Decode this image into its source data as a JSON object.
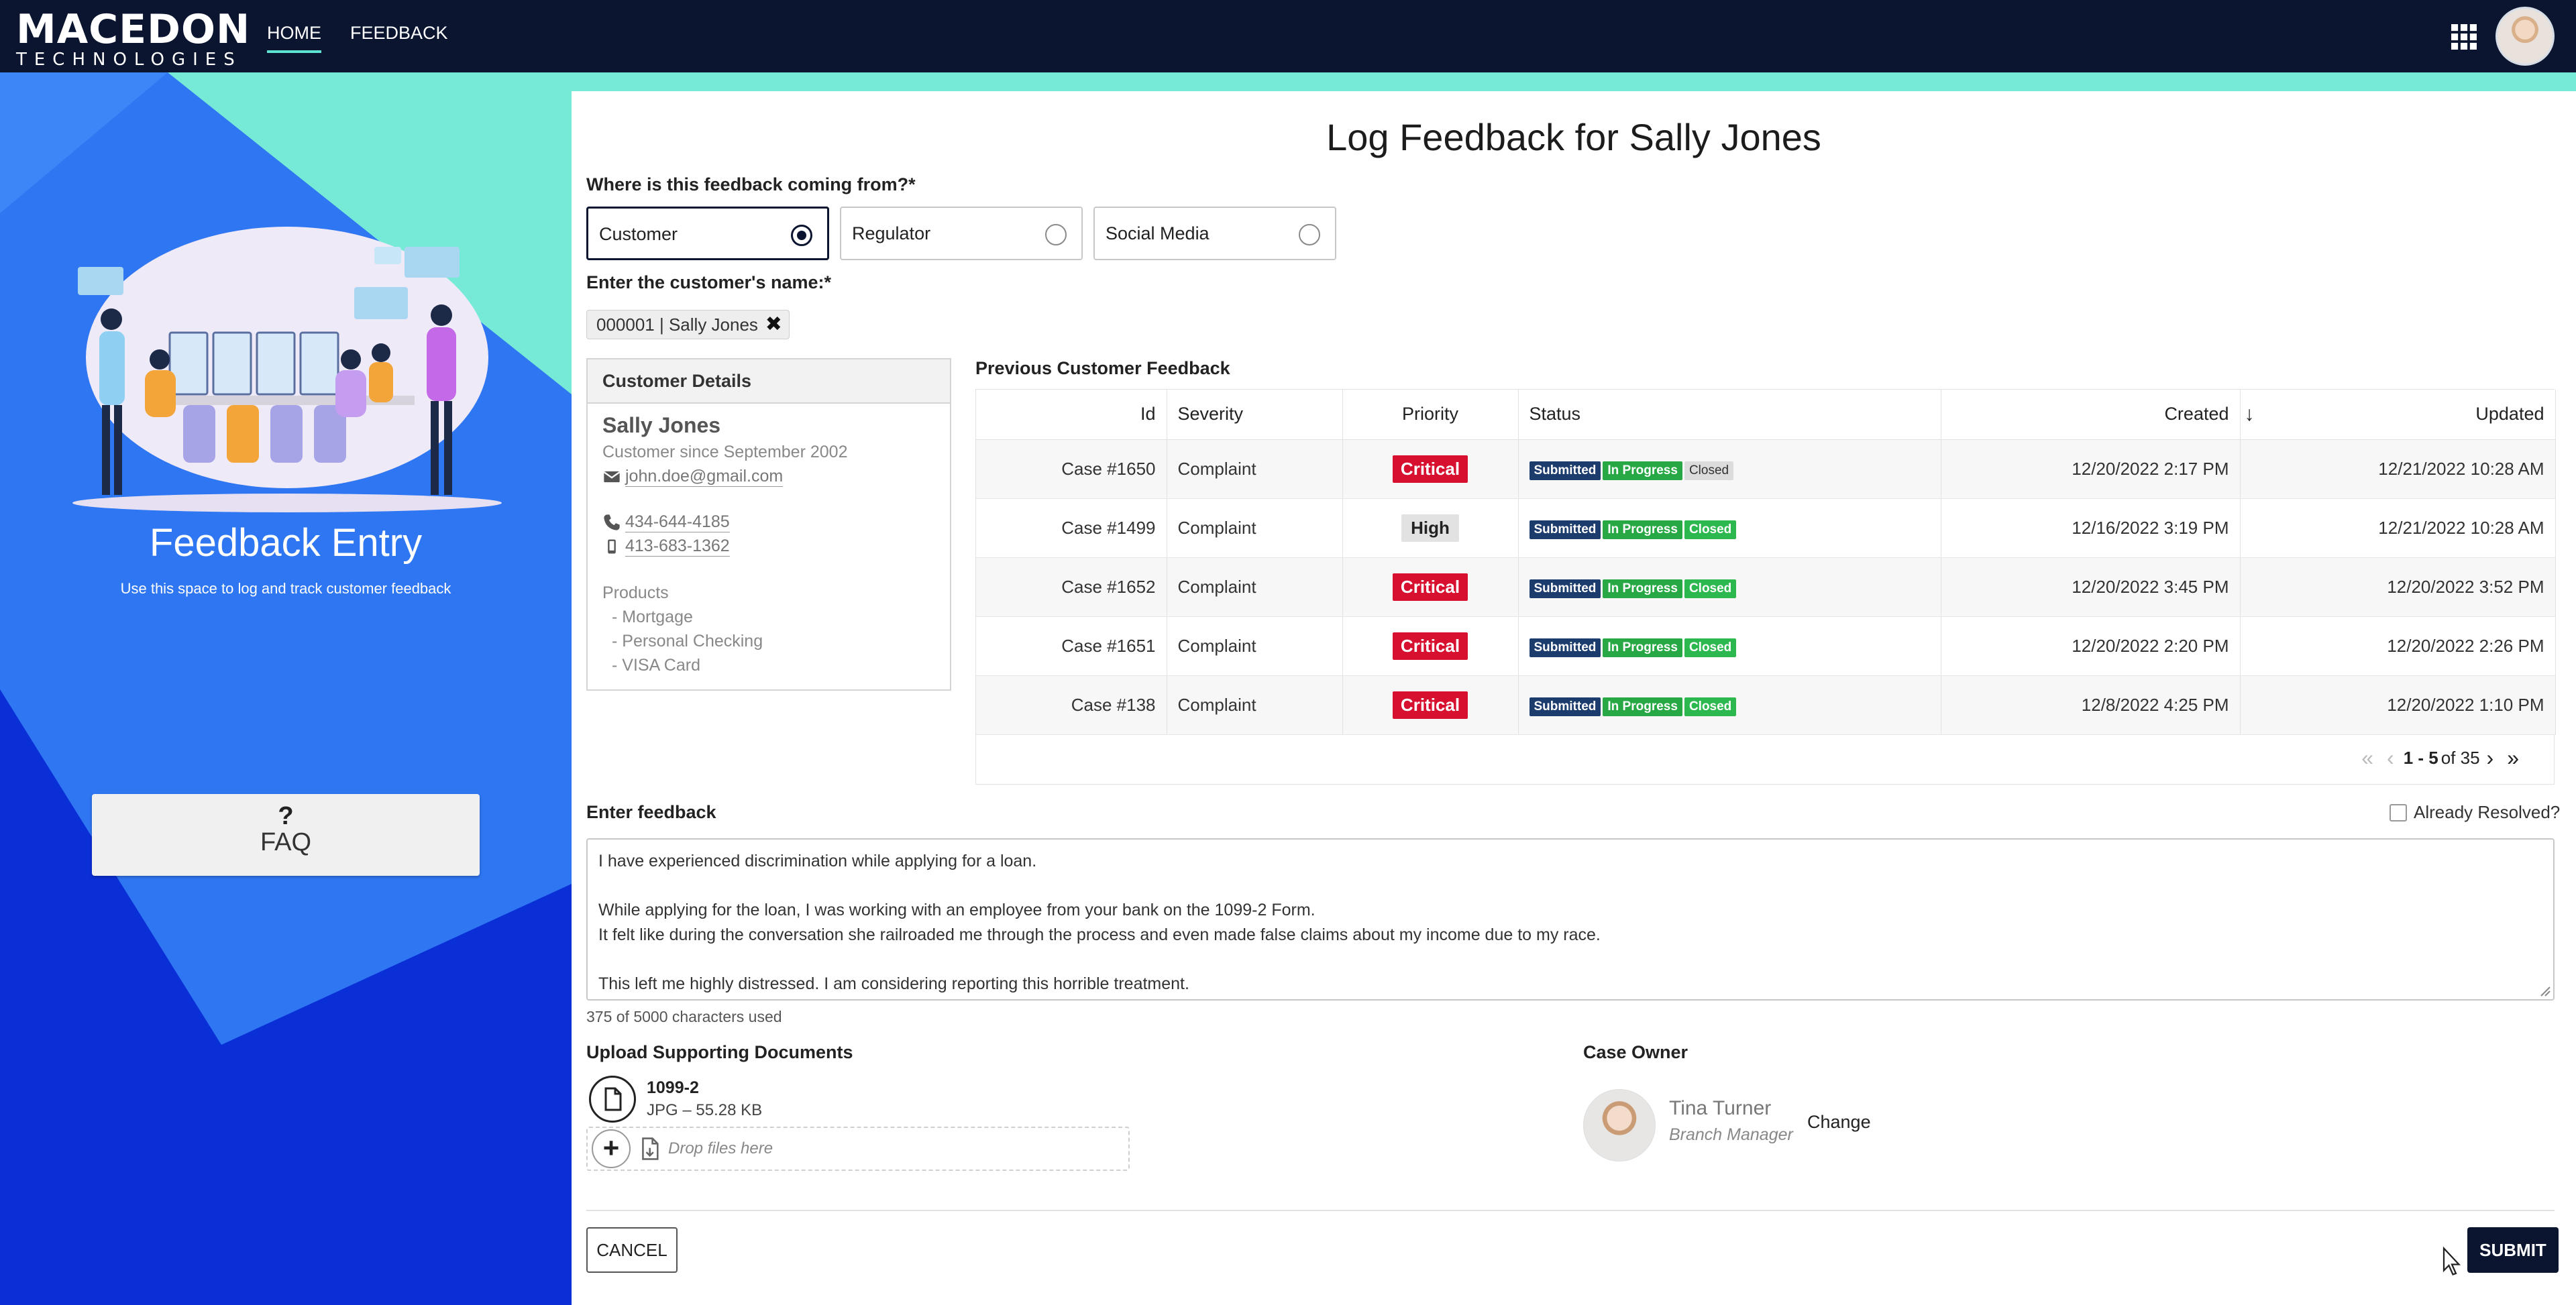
{
  "brand": {
    "name": "MACEDON",
    "sub": "TECHNOLOGIES",
    "accent": "#76ead7",
    "navy": "#0b1530"
  },
  "nav": {
    "home": "HOME",
    "feedback": "FEEDBACK",
    "apps_icon": "apps-grid-icon",
    "avatar": "user-avatar"
  },
  "left": {
    "title": "Feedback Entry",
    "subtitle": "Use this space to log and track customer feedback",
    "faq_symbol": "?",
    "faq_label": "FAQ"
  },
  "form": {
    "title": "Log Feedback for Sally Jones",
    "source_label": "Where is this feedback coming from?",
    "required": "*",
    "sources": [
      {
        "label": "Customer",
        "selected": true
      },
      {
        "label": "Regulator",
        "selected": false
      },
      {
        "label": "Social Media",
        "selected": false
      }
    ],
    "customer_label": "Enter the customer's name:",
    "customer_chip": "000001 | Sally Jones",
    "chip_remove": "✖"
  },
  "customer": {
    "header": "Customer Details",
    "name": "Sally Jones",
    "since": "Customer since September 2002",
    "email": "john.doe@gmail.com",
    "phone": "434-644-4185",
    "mobile": "413-683-1362",
    "products_label": "Products",
    "products": [
      "- Mortgage",
      "- Personal Checking",
      "- VISA Card"
    ]
  },
  "previous": {
    "title": "Previous Customer Feedback",
    "columns": [
      "Id",
      "Severity",
      "Priority",
      "Status",
      "Created",
      "Updated"
    ],
    "sort_indicator": "↓",
    "rows": [
      {
        "id": "Case #1650",
        "severity": "Complaint",
        "priority": "Critical",
        "status": [
          "Submitted",
          "In Progress",
          "Closed"
        ],
        "created": "12/20/2022 2:17 PM",
        "updated": "12/21/2022 10:28 AM"
      },
      {
        "id": "Case #1499",
        "severity": "Complaint",
        "priority": "High",
        "status": [
          "Submitted",
          "In Progress",
          "Closed"
        ],
        "created": "12/16/2022 3:19 PM",
        "updated": "12/21/2022 10:28 AM"
      },
      {
        "id": "Case #1652",
        "severity": "Complaint",
        "priority": "Critical",
        "status": [
          "Submitted",
          "In Progress",
          "Closed"
        ],
        "created": "12/20/2022 3:45 PM",
        "updated": "12/20/2022 3:52 PM"
      },
      {
        "id": "Case #1651",
        "severity": "Complaint",
        "priority": "Critical",
        "status": [
          "Submitted",
          "In Progress",
          "Closed"
        ],
        "created": "12/20/2022 2:20 PM",
        "updated": "12/20/2022 2:26 PM"
      },
      {
        "id": "Case #138",
        "severity": "Complaint",
        "priority": "Critical",
        "status": [
          "Submitted",
          "In Progress",
          "Closed"
        ],
        "created": "12/8/2022 4:25 PM",
        "updated": "12/20/2022 1:10 PM"
      }
    ],
    "pager": {
      "range": "1 - 5",
      "of": "of 35"
    }
  },
  "feedback": {
    "label": "Enter feedback",
    "resolved_label": "Already Resolved?",
    "lines": [
      "I have experienced discrimination while applying for a loan.",
      "",
      "While applying for the loan, I was working with an employee from your bank on the 1099-2 Form.",
      "It felt like during the conversation she railroaded me through the process and even made false claims about my income due to my race.",
      "",
      "This left me highly distressed. I am considering reporting this horrible treatment."
    ],
    "char_count": "375 of 5000 characters used"
  },
  "upload": {
    "label": "Upload Supporting Documents",
    "file_name": "1099-2",
    "file_meta": "JPG – 55.28 KB",
    "drop_text": "Drop files here",
    "add": "+"
  },
  "owner": {
    "label": "Case Owner",
    "name": "Tina Turner",
    "role": "Branch Manager",
    "change": "Change"
  },
  "actions": {
    "cancel": "CANCEL",
    "submit": "SUBMIT"
  },
  "colors": {
    "critical": "#d8102f",
    "submitted": "#1d3c6e",
    "progress": "#27a844",
    "closed": "#2db84f",
    "left_blue": "#2f76f2",
    "left_dark": "#0b2fd6"
  }
}
